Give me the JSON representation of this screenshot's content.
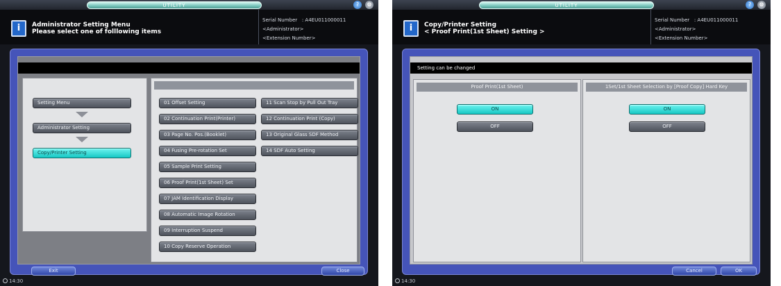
{
  "left": {
    "utility_title": "UTILITY",
    "header": {
      "title_line1": "Administrator Setting Menu",
      "title_line2": "Please select one of folllowing items",
      "serial_label": "Serial Number",
      "serial_value": ": A4EU011000011",
      "admin": "<Administrator>",
      "extension": "<Extension Number>"
    },
    "breadcrumb": [
      "Setting Menu",
      "Administrator Setting",
      "Copy/Printer Setting"
    ],
    "menu_col1": [
      "01 Offset Setting",
      "02 Continuation Print(Printer)",
      "03 Page No. Pos.(Booklet)",
      "04 Fusing Pre-rotation Set",
      "05 Sample Print Setting",
      "06 Proof Print(1st Sheet) Set",
      "07 JAM Identification Display",
      "08 Automatic Image Rotation",
      "09 Interruption Suspend",
      "10 Copy Reserve Operation"
    ],
    "menu_col2": [
      "11 Scan Stop by Pull Out Tray",
      "12 Continuation Print (Copy)",
      "13 Original Glass SDF Method",
      "14 SDF Auto Setting"
    ],
    "exit_label": "Exit",
    "close_label": "Close",
    "clock": "14:30"
  },
  "right": {
    "utility_title": "UTILITY",
    "header": {
      "title_line1": "Copy/Printer Setting",
      "title_line2": "< Proof Print(1st Sheet) Setting >",
      "serial_label": "Serial Number",
      "serial_value": ": A4EU011000011",
      "admin": "<Administrator>",
      "extension": "<Extension Number>"
    },
    "status_text": "Setting can be changed",
    "panel1_title": "Proof Print(1st Sheet)",
    "panel2_title": "1Set/1st Sheet Selection by [Proof Copy] Hard Key",
    "on_label": "ON",
    "off_label": "OFF",
    "selected": "ON",
    "cancel_label": "Cancel",
    "ok_label": "OK",
    "clock": "14:30"
  },
  "colors": {
    "accent_cyan": "#16c8c4",
    "frame_blue": "#4554b9",
    "header_black": "#0b0c0f"
  }
}
